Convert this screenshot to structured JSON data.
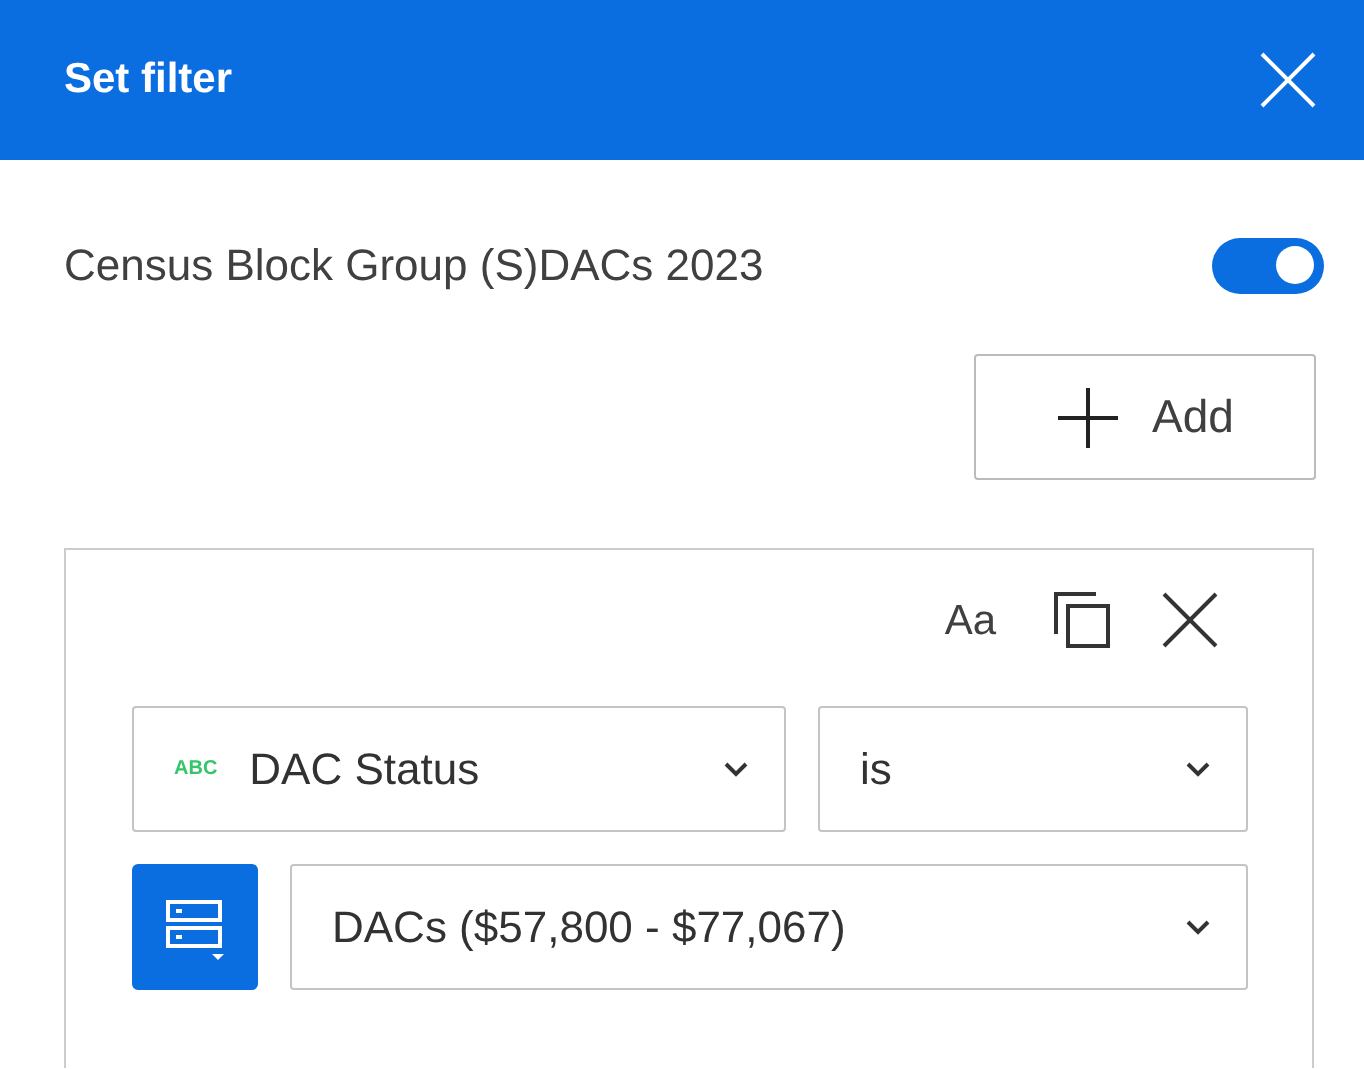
{
  "header": {
    "title": "Set filter"
  },
  "layer": {
    "name": "Census Block Group (S)DACs 2023",
    "on": true
  },
  "add_button": {
    "label": "Add"
  },
  "expression": {
    "case_toggle": "Aa",
    "field": {
      "type_label": "ABC",
      "value": "DAC Status"
    },
    "operator": {
      "value": "is"
    },
    "value": {
      "value": "DACs ($57,800 - $77,067)"
    }
  }
}
